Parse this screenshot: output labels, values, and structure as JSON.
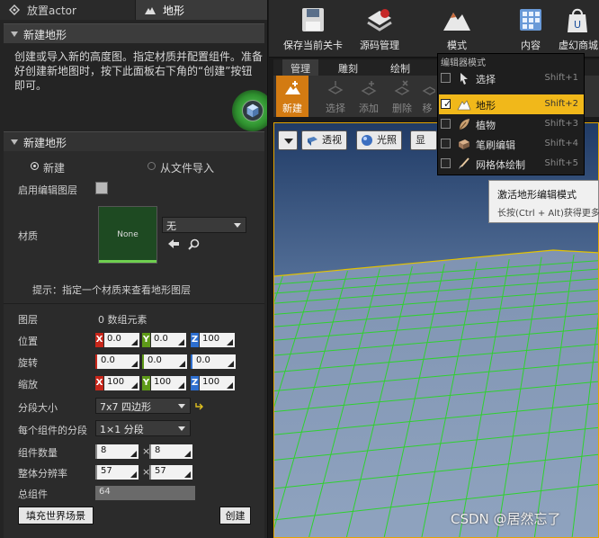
{
  "tabs": [
    {
      "label": "放置actor",
      "icon": "place-actor-icon"
    },
    {
      "label": "地形",
      "icon": "landscape-mountain-icon"
    }
  ],
  "section_new_landscape": {
    "header": "新建地形",
    "description": "创建或导入新的高度图。指定材质并配置组件。准备好创建新地图时，按下此面板右下角的“创建”按钮即可。"
  },
  "panel": {
    "header": "新建地形",
    "radio_new": "新建",
    "radio_import": "从文件导入",
    "enable_edit_layers_label": "启用编辑图层",
    "enable_edit_layers_checked": false,
    "material_label": "材质",
    "material_thumb_text": "None",
    "material_value": "无",
    "hint": "提示：指定一个材质来查看地形图层",
    "layers_label": "图层",
    "layers_value": "0 数组元素",
    "location_label": "位置",
    "location": {
      "x": "0.0",
      "y": "0.0",
      "z": "100"
    },
    "rotation_label": "旋转",
    "rotation": {
      "x": "0.0",
      "y": "0.0",
      "z": "0.0"
    },
    "scale_label": "缩放",
    "scale": {
      "x": "100",
      "y": "100",
      "z": "100"
    },
    "section_size_label": "分段大小",
    "section_size_value": "7x7 四边形",
    "sections_per_component_label": "每个组件的分段",
    "sections_per_component_value": "1×1 分段",
    "component_count_label": "组件数量",
    "component_count": {
      "x": "8",
      "sep": "×",
      "y": "8"
    },
    "resolution_label": "整体分辨率",
    "resolution": {
      "x": "57",
      "sep": "×",
      "y": "57"
    },
    "total_components_label": "总组件",
    "total_components_value": "64",
    "fill_world_button": "填充世界场景",
    "create_button": "创建"
  },
  "toolbar": {
    "save_label": "保存当前关卡",
    "source_control_label": "源码管理",
    "modes_label": "模式",
    "content_label": "内容",
    "marketplace_label": "虚幻商城"
  },
  "mode_tabs": [
    {
      "label": "管理",
      "active": true
    },
    {
      "label": "雕刻",
      "active": false
    },
    {
      "label": "绘制",
      "active": false
    }
  ],
  "sub_tools": [
    {
      "label": "新建",
      "active": true
    },
    {
      "label": "选择",
      "active": false
    },
    {
      "label": "添加",
      "active": false
    },
    {
      "label": "删除",
      "active": false
    },
    {
      "label": "移",
      "active": false
    }
  ],
  "viewport_tools": {
    "perspective_label": "透视",
    "lit_label": "光照",
    "show_label": "显示"
  },
  "editor_modes_menu": {
    "title": "编辑器模式",
    "items": [
      {
        "label": "选择",
        "shortcut": "Shift+1",
        "checked": false,
        "selected": false,
        "icon": "select-cursor-icon"
      },
      {
        "label": "地形",
        "shortcut": "Shift+2",
        "checked": true,
        "selected": true,
        "icon": "landscape-mountain-icon"
      },
      {
        "label": "植物",
        "shortcut": "Shift+3",
        "checked": false,
        "selected": false,
        "icon": "foliage-leaf-icon"
      },
      {
        "label": "笔刷编辑",
        "shortcut": "Shift+4",
        "checked": false,
        "selected": false,
        "icon": "brush-edit-icon"
      },
      {
        "label": "网格体绘制",
        "shortcut": "Shift+5",
        "checked": false,
        "selected": false,
        "icon": "mesh-paint-brush-icon"
      }
    ]
  },
  "tooltip": {
    "title": "激活地形编辑模式",
    "subtitle": "长按(Ctrl + Alt)获得更多"
  },
  "watermark": "CSDN @居然忘了",
  "colors": {
    "accent_orange": "#d37b12",
    "menu_highlight": "#f1b81a",
    "grid_green": "#2fd12f",
    "grid_border": "#e3c200"
  }
}
